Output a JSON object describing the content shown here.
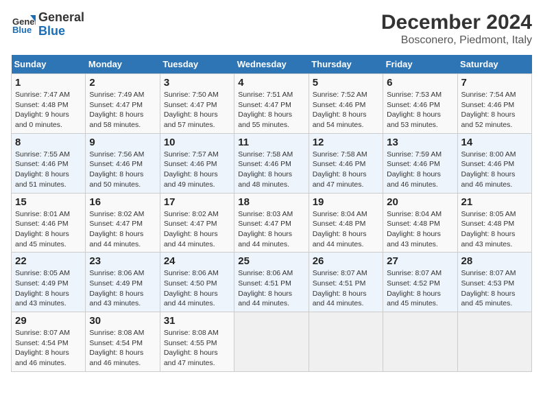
{
  "logo": {
    "line1": "General",
    "line2": "Blue"
  },
  "title": "December 2024",
  "subtitle": "Bosconero, Piedmont, Italy",
  "weekdays": [
    "Sunday",
    "Monday",
    "Tuesday",
    "Wednesday",
    "Thursday",
    "Friday",
    "Saturday"
  ],
  "weeks": [
    [
      {
        "day": "1",
        "sunrise": "Sunrise: 7:47 AM",
        "sunset": "Sunset: 4:48 PM",
        "daylight": "Daylight: 9 hours and 0 minutes."
      },
      {
        "day": "2",
        "sunrise": "Sunrise: 7:49 AM",
        "sunset": "Sunset: 4:47 PM",
        "daylight": "Daylight: 8 hours and 58 minutes."
      },
      {
        "day": "3",
        "sunrise": "Sunrise: 7:50 AM",
        "sunset": "Sunset: 4:47 PM",
        "daylight": "Daylight: 8 hours and 57 minutes."
      },
      {
        "day": "4",
        "sunrise": "Sunrise: 7:51 AM",
        "sunset": "Sunset: 4:47 PM",
        "daylight": "Daylight: 8 hours and 55 minutes."
      },
      {
        "day": "5",
        "sunrise": "Sunrise: 7:52 AM",
        "sunset": "Sunset: 4:46 PM",
        "daylight": "Daylight: 8 hours and 54 minutes."
      },
      {
        "day": "6",
        "sunrise": "Sunrise: 7:53 AM",
        "sunset": "Sunset: 4:46 PM",
        "daylight": "Daylight: 8 hours and 53 minutes."
      },
      {
        "day": "7",
        "sunrise": "Sunrise: 7:54 AM",
        "sunset": "Sunset: 4:46 PM",
        "daylight": "Daylight: 8 hours and 52 minutes."
      }
    ],
    [
      {
        "day": "8",
        "sunrise": "Sunrise: 7:55 AM",
        "sunset": "Sunset: 4:46 PM",
        "daylight": "Daylight: 8 hours and 51 minutes."
      },
      {
        "day": "9",
        "sunrise": "Sunrise: 7:56 AM",
        "sunset": "Sunset: 4:46 PM",
        "daylight": "Daylight: 8 hours and 50 minutes."
      },
      {
        "day": "10",
        "sunrise": "Sunrise: 7:57 AM",
        "sunset": "Sunset: 4:46 PM",
        "daylight": "Daylight: 8 hours and 49 minutes."
      },
      {
        "day": "11",
        "sunrise": "Sunrise: 7:58 AM",
        "sunset": "Sunset: 4:46 PM",
        "daylight": "Daylight: 8 hours and 48 minutes."
      },
      {
        "day": "12",
        "sunrise": "Sunrise: 7:58 AM",
        "sunset": "Sunset: 4:46 PM",
        "daylight": "Daylight: 8 hours and 47 minutes."
      },
      {
        "day": "13",
        "sunrise": "Sunrise: 7:59 AM",
        "sunset": "Sunset: 4:46 PM",
        "daylight": "Daylight: 8 hours and 46 minutes."
      },
      {
        "day": "14",
        "sunrise": "Sunrise: 8:00 AM",
        "sunset": "Sunset: 4:46 PM",
        "daylight": "Daylight: 8 hours and 46 minutes."
      }
    ],
    [
      {
        "day": "15",
        "sunrise": "Sunrise: 8:01 AM",
        "sunset": "Sunset: 4:46 PM",
        "daylight": "Daylight: 8 hours and 45 minutes."
      },
      {
        "day": "16",
        "sunrise": "Sunrise: 8:02 AM",
        "sunset": "Sunset: 4:47 PM",
        "daylight": "Daylight: 8 hours and 44 minutes."
      },
      {
        "day": "17",
        "sunrise": "Sunrise: 8:02 AM",
        "sunset": "Sunset: 4:47 PM",
        "daylight": "Daylight: 8 hours and 44 minutes."
      },
      {
        "day": "18",
        "sunrise": "Sunrise: 8:03 AM",
        "sunset": "Sunset: 4:47 PM",
        "daylight": "Daylight: 8 hours and 44 minutes."
      },
      {
        "day": "19",
        "sunrise": "Sunrise: 8:04 AM",
        "sunset": "Sunset: 4:48 PM",
        "daylight": "Daylight: 8 hours and 44 minutes."
      },
      {
        "day": "20",
        "sunrise": "Sunrise: 8:04 AM",
        "sunset": "Sunset: 4:48 PM",
        "daylight": "Daylight: 8 hours and 43 minutes."
      },
      {
        "day": "21",
        "sunrise": "Sunrise: 8:05 AM",
        "sunset": "Sunset: 4:48 PM",
        "daylight": "Daylight: 8 hours and 43 minutes."
      }
    ],
    [
      {
        "day": "22",
        "sunrise": "Sunrise: 8:05 AM",
        "sunset": "Sunset: 4:49 PM",
        "daylight": "Daylight: 8 hours and 43 minutes."
      },
      {
        "day": "23",
        "sunrise": "Sunrise: 8:06 AM",
        "sunset": "Sunset: 4:49 PM",
        "daylight": "Daylight: 8 hours and 43 minutes."
      },
      {
        "day": "24",
        "sunrise": "Sunrise: 8:06 AM",
        "sunset": "Sunset: 4:50 PM",
        "daylight": "Daylight: 8 hours and 44 minutes."
      },
      {
        "day": "25",
        "sunrise": "Sunrise: 8:06 AM",
        "sunset": "Sunset: 4:51 PM",
        "daylight": "Daylight: 8 hours and 44 minutes."
      },
      {
        "day": "26",
        "sunrise": "Sunrise: 8:07 AM",
        "sunset": "Sunset: 4:51 PM",
        "daylight": "Daylight: 8 hours and 44 minutes."
      },
      {
        "day": "27",
        "sunrise": "Sunrise: 8:07 AM",
        "sunset": "Sunset: 4:52 PM",
        "daylight": "Daylight: 8 hours and 45 minutes."
      },
      {
        "day": "28",
        "sunrise": "Sunrise: 8:07 AM",
        "sunset": "Sunset: 4:53 PM",
        "daylight": "Daylight: 8 hours and 45 minutes."
      }
    ],
    [
      {
        "day": "29",
        "sunrise": "Sunrise: 8:07 AM",
        "sunset": "Sunset: 4:54 PM",
        "daylight": "Daylight: 8 hours and 46 minutes."
      },
      {
        "day": "30",
        "sunrise": "Sunrise: 8:08 AM",
        "sunset": "Sunset: 4:54 PM",
        "daylight": "Daylight: 8 hours and 46 minutes."
      },
      {
        "day": "31",
        "sunrise": "Sunrise: 8:08 AM",
        "sunset": "Sunset: 4:55 PM",
        "daylight": "Daylight: 8 hours and 47 minutes."
      },
      null,
      null,
      null,
      null
    ]
  ]
}
